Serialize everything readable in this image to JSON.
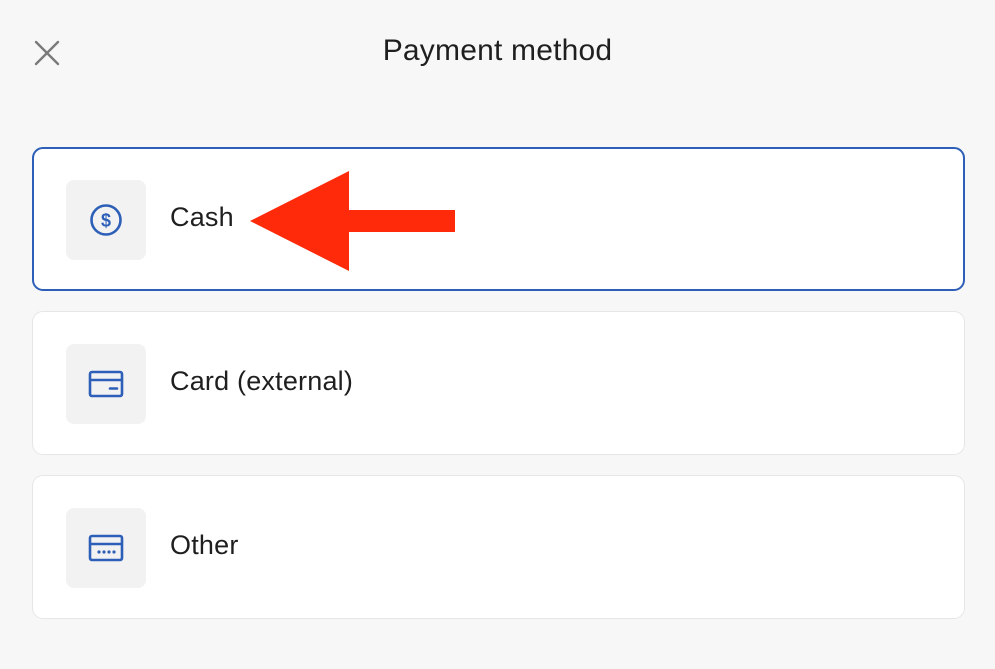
{
  "dialog": {
    "title": "Payment method",
    "close_icon": "close-icon"
  },
  "options": [
    {
      "label": "Cash",
      "icon": "dollar-circle-icon",
      "selected": true
    },
    {
      "label": "Card (external)",
      "icon": "card-icon",
      "selected": false
    },
    {
      "label": "Other",
      "icon": "card-dots-icon",
      "selected": false
    }
  ],
  "annotation": {
    "type": "arrow",
    "points_to": "Cash",
    "color": "#ff2a0a"
  },
  "colors": {
    "accent": "#2d5fb8",
    "background": "#f7f7f7",
    "tile": "#f2f2f2"
  }
}
